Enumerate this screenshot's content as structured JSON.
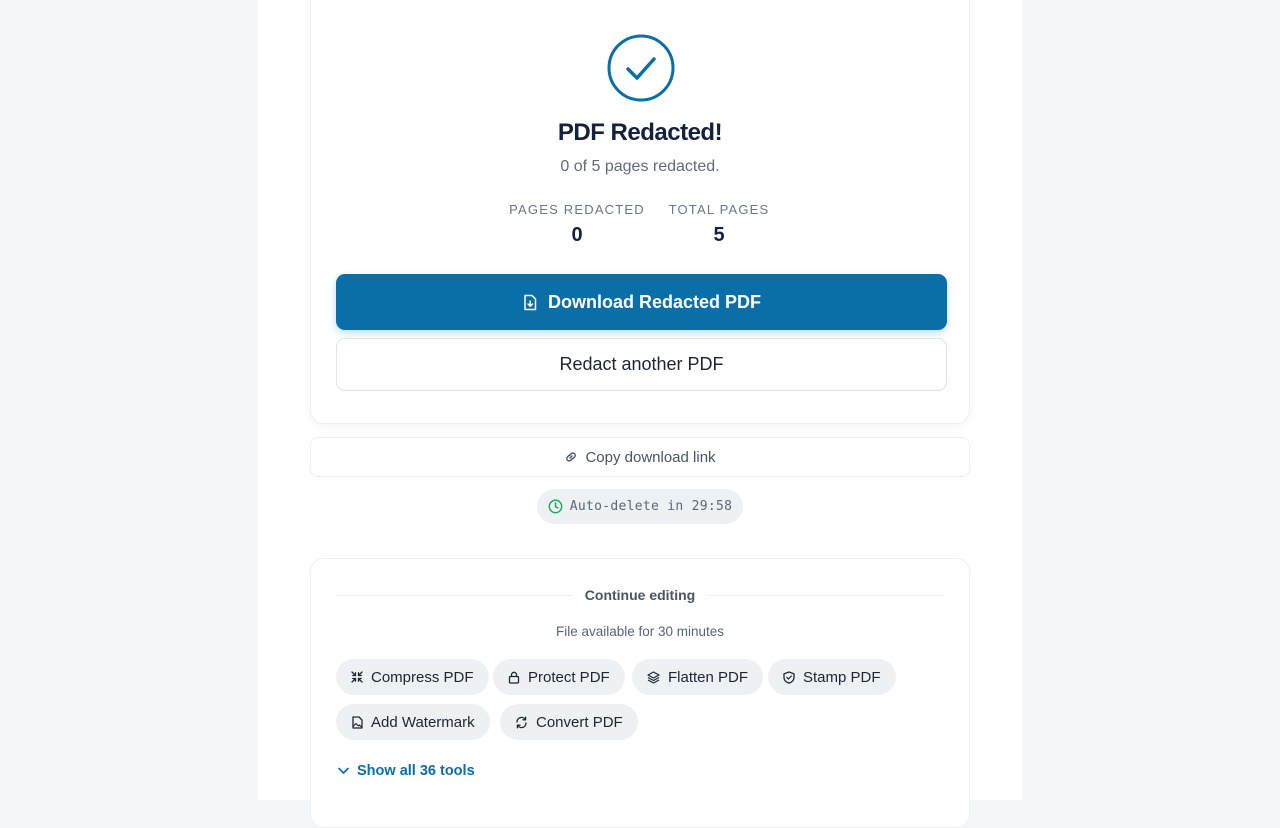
{
  "result": {
    "title": "PDF Redacted!",
    "subtitle": "0 of 5 pages redacted.",
    "stats": [
      {
        "label": "PAGES REDACTED",
        "value": "0"
      },
      {
        "label": "TOTAL PAGES",
        "value": "5"
      }
    ],
    "download_label": "Download Redacted PDF",
    "redact_another_label": "Redact another PDF"
  },
  "copy_link_label": "Copy download link",
  "auto_delete_label": "Auto-delete in 29:58",
  "continue": {
    "heading": "Continue editing",
    "availability": "File available for 30 minutes",
    "tools": [
      {
        "label": "Compress PDF",
        "icon": "compress-icon"
      },
      {
        "label": "Protect PDF",
        "icon": "lock-icon"
      },
      {
        "label": "Flatten PDF",
        "icon": "layers-icon"
      },
      {
        "label": "Stamp PDF",
        "icon": "shield-icon"
      },
      {
        "label": "Add Watermark",
        "icon": "image-file-icon"
      },
      {
        "label": "Convert PDF",
        "icon": "refresh-icon"
      }
    ],
    "show_all_label": "Show all 36 tools"
  },
  "colors": {
    "accent": "#0a6fa8",
    "success": "#22a565",
    "background": "#f5f6f8"
  }
}
